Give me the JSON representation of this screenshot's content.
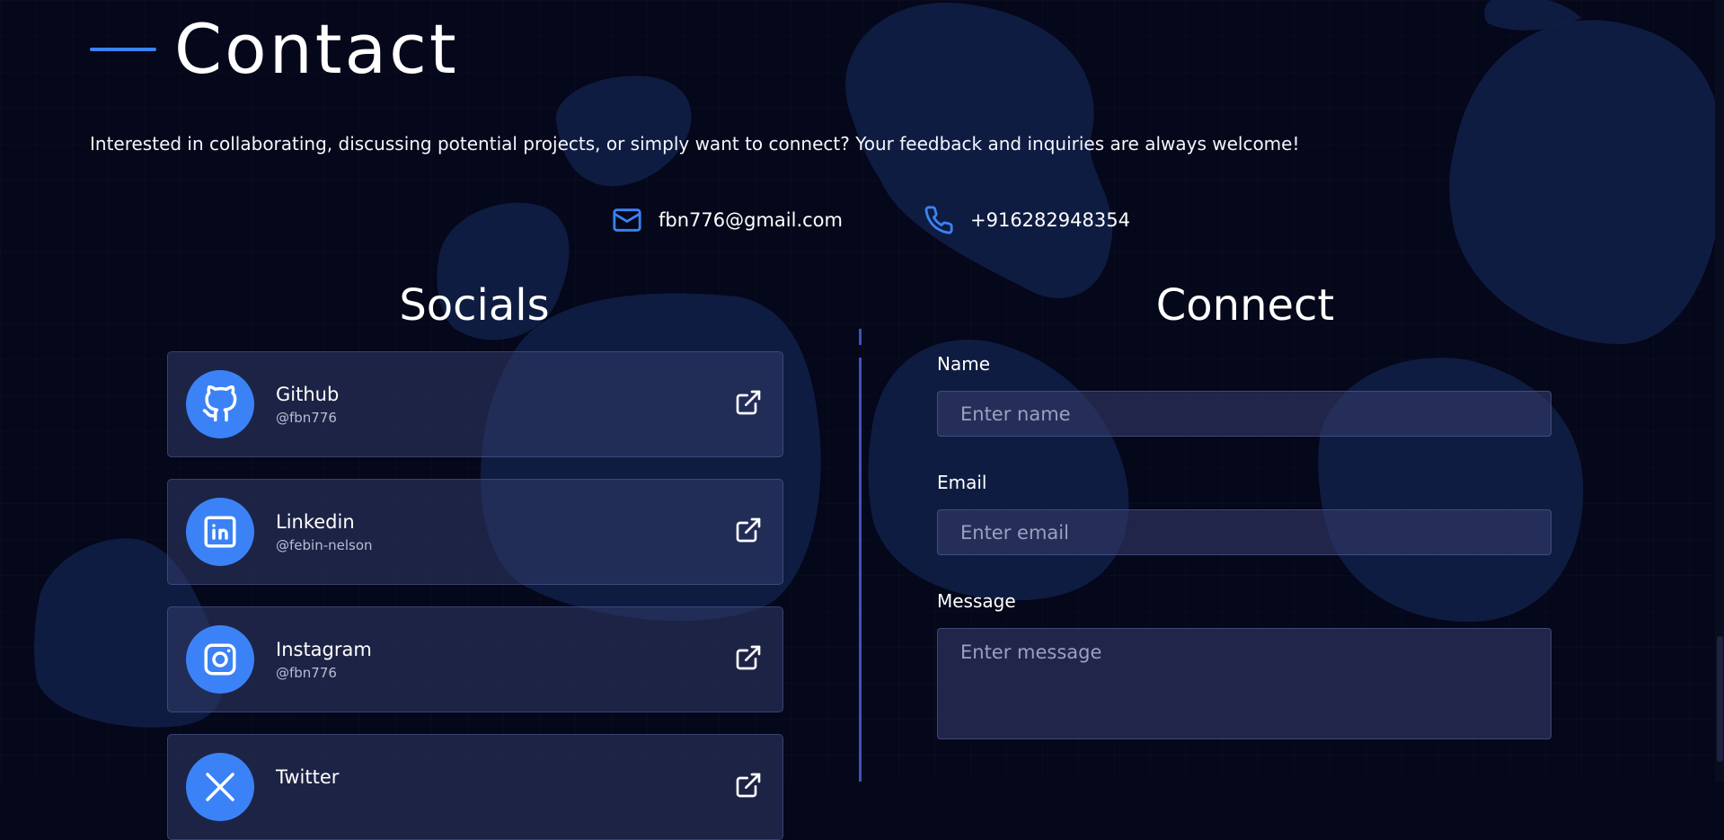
{
  "page": {
    "title": "Contact",
    "intro": "Interested in collaborating, discussing potential projects, or simply want to connect? Your feedback and inquiries are always welcome!",
    "accent_color": "#3b82f6",
    "background_color": "#05071a"
  },
  "contact": {
    "email": {
      "icon": "mail-icon",
      "value": "fbn776@gmail.com"
    },
    "phone": {
      "icon": "phone-icon",
      "value": "+916282948354"
    }
  },
  "socials": {
    "title": "Socials",
    "items": [
      {
        "name": "Github",
        "handle": "@fbn776",
        "icon": "github-icon"
      },
      {
        "name": "Linkedin",
        "handle": "@febin-nelson",
        "icon": "linkedin-icon"
      },
      {
        "name": "Instagram",
        "handle": "@fbn776",
        "icon": "instagram-icon"
      },
      {
        "name": "Twitter",
        "handle": "",
        "icon": "x-twitter-icon"
      }
    ],
    "external_link_icon": "external-link-icon"
  },
  "connect": {
    "title": "Connect",
    "name_label": "Name",
    "name_placeholder": "Enter name",
    "email_label": "Email",
    "email_placeholder": "Enter email",
    "message_label": "Message",
    "message_placeholder": "Enter message"
  }
}
